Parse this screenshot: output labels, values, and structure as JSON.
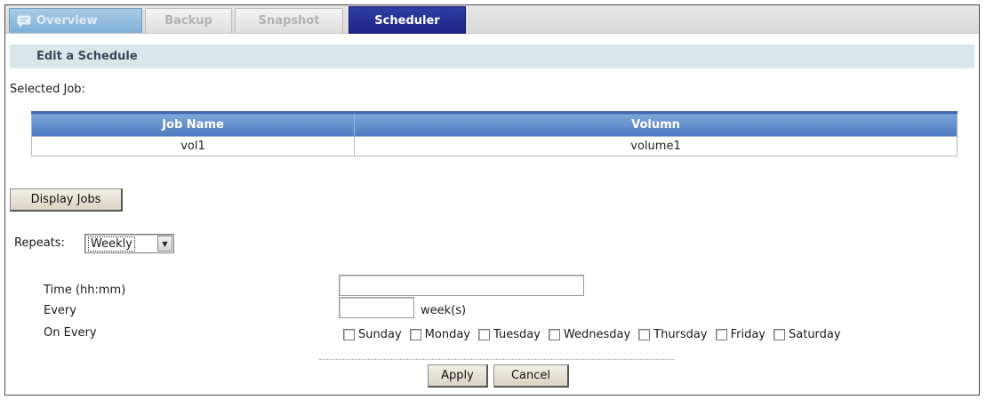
{
  "tabs": [
    {
      "label": "Overview",
      "icon": "chat-bubble-icon",
      "state": "inactive"
    },
    {
      "label": "Backup",
      "state": "disabled"
    },
    {
      "label": "Snapshot",
      "state": "disabled"
    },
    {
      "label": "Scheduler",
      "state": "active"
    }
  ],
  "section_title": "Edit a Schedule",
  "selected_job_label": "Selected Job:",
  "job_table": {
    "columns": [
      "Job Name",
      "Volumn"
    ],
    "rows": [
      [
        "vol1",
        "volume1"
      ]
    ]
  },
  "display_jobs_button": "Display Jobs",
  "repeats": {
    "label": "Repeats:",
    "selected": "Weekly"
  },
  "form": {
    "time_label": "Time (hh:mm)",
    "time_value": "",
    "every_label": "Every",
    "every_value": "",
    "every_unit": "week(s)",
    "on_every_label": "On Every",
    "days": [
      {
        "label": "Sunday",
        "checked": false
      },
      {
        "label": "Monday",
        "checked": false
      },
      {
        "label": "Tuesday",
        "checked": false
      },
      {
        "label": "Wednesday",
        "checked": false
      },
      {
        "label": "Thursday",
        "checked": false
      },
      {
        "label": "Friday",
        "checked": false
      },
      {
        "label": "Saturday",
        "checked": false
      }
    ]
  },
  "buttons": {
    "apply": "Apply",
    "cancel": "Cancel"
  },
  "colors": {
    "active_tab": "#1d2484",
    "overview_tab": "#7fb0d6",
    "section_header_bg": "#d9e7ea",
    "table_header": "#4d7ac0"
  }
}
